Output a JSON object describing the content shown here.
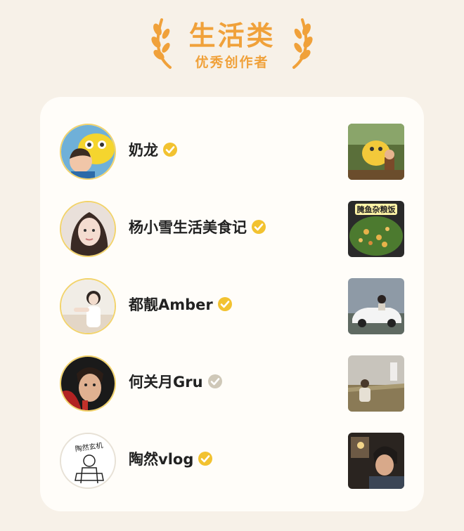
{
  "header": {
    "title": "生活类",
    "subtitle": "优秀创作者"
  },
  "colors": {
    "accent_orange": "#f0a13a",
    "verified_gold": "#f2c230",
    "verified_gray": "#cfc8b8",
    "background": "#f7f1e8",
    "card": "#fffdf9"
  },
  "creators": [
    {
      "name": "奶龙",
      "verified_color": "gold",
      "avatar_icon": "cartoon-avatar-icon",
      "thumb_icon": "cartoon-thumbnail-icon"
    },
    {
      "name": "杨小雪生活美食记",
      "verified_color": "gold",
      "avatar_icon": "portrait-avatar-icon",
      "thumb_icon": "food-thumbnail-icon",
      "thumb_text": "腌鱼杂粮饭"
    },
    {
      "name": "都靓Amber",
      "verified_color": "gold",
      "avatar_icon": "portrait-avatar-icon",
      "thumb_icon": "car-thumbnail-icon"
    },
    {
      "name": "何关月Gru",
      "verified_color": "gray",
      "avatar_icon": "portrait-avatar-icon",
      "thumb_icon": "field-thumbnail-icon"
    },
    {
      "name": "陶然vlog",
      "verified_color": "gold",
      "avatar_icon": "sketch-avatar-icon",
      "thumb_icon": "portrait-thumbnail-icon",
      "avatar_text": "陶然玄机"
    }
  ]
}
